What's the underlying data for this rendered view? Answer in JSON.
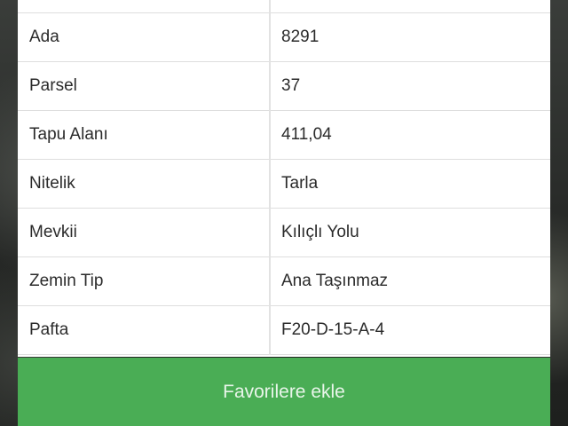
{
  "table": {
    "rows": [
      {
        "label": "",
        "value": ""
      },
      {
        "label": "Ada",
        "value": "8291"
      },
      {
        "label": "Parsel",
        "value": "37"
      },
      {
        "label": "Tapu Alanı",
        "value": "411,04"
      },
      {
        "label": "Nitelik",
        "value": "Tarla"
      },
      {
        "label": "Mevkii",
        "value": "Kılıçlı Yolu"
      },
      {
        "label": "Zemin Tip",
        "value": "Ana Taşınmaz"
      },
      {
        "label": "Pafta",
        "value": "F20-D-15-A-4"
      }
    ]
  },
  "actions": {
    "favorite_label": "Favorilere ekle"
  },
  "colors": {
    "button_green": "#4aad55",
    "panel_background": "#ffffff",
    "divider": "#dedede"
  }
}
